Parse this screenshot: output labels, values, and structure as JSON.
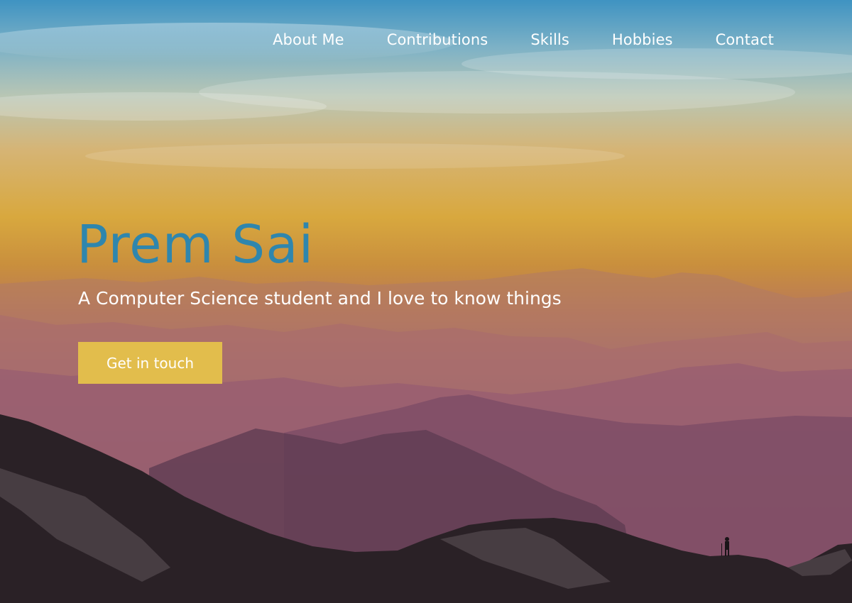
{
  "nav": {
    "items": [
      {
        "label": "About Me"
      },
      {
        "label": "Contributions"
      },
      {
        "label": "Skills"
      },
      {
        "label": "Hobbies"
      },
      {
        "label": "Contact"
      }
    ]
  },
  "hero": {
    "title": "Prem Sai",
    "subtitle": "A Computer Science student and I love to know things",
    "cta_label": "Get in touch"
  },
  "colors": {
    "title": "#2f86ad",
    "cta_background": "#e2bd4c",
    "nav_text": "#ffffff"
  }
}
